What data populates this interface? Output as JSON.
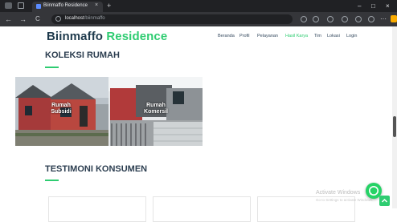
{
  "browser": {
    "tab_title": "Biinmaffo Residence",
    "tab_close": "×",
    "new_tab": "+",
    "url_host": "localhost",
    "url_path": "/biinmaffo",
    "nav_back": "←",
    "nav_forward": "→",
    "nav_reload": "C",
    "window_min": "–",
    "window_max": "□",
    "window_close": "×"
  },
  "site": {
    "brand_main": "Biinmaffo",
    "brand_accent": "Residence",
    "menu": [
      "Beranda",
      "Profil",
      "Pelayanan",
      "Hasil Karya",
      "Tim",
      "Lokasi",
      "Login"
    ],
    "active_menu_index": 3
  },
  "koleksi": {
    "title": "KOLEKSI RUMAH",
    "items": [
      {
        "line1": "Rumah",
        "line2": "Subsidi"
      },
      {
        "line1": "Rumah",
        "line2": "Komersil"
      }
    ]
  },
  "testimoni": {
    "title": "TESTIMONI KONSUMEN"
  },
  "overlay": {
    "watermark_title": "Activate Windows",
    "watermark_sub": "Go to Settings to activate Windows."
  },
  "colors": {
    "accent": "#2ecc71",
    "brand": "#1e3a4c",
    "chrome_dark": "#202124"
  }
}
